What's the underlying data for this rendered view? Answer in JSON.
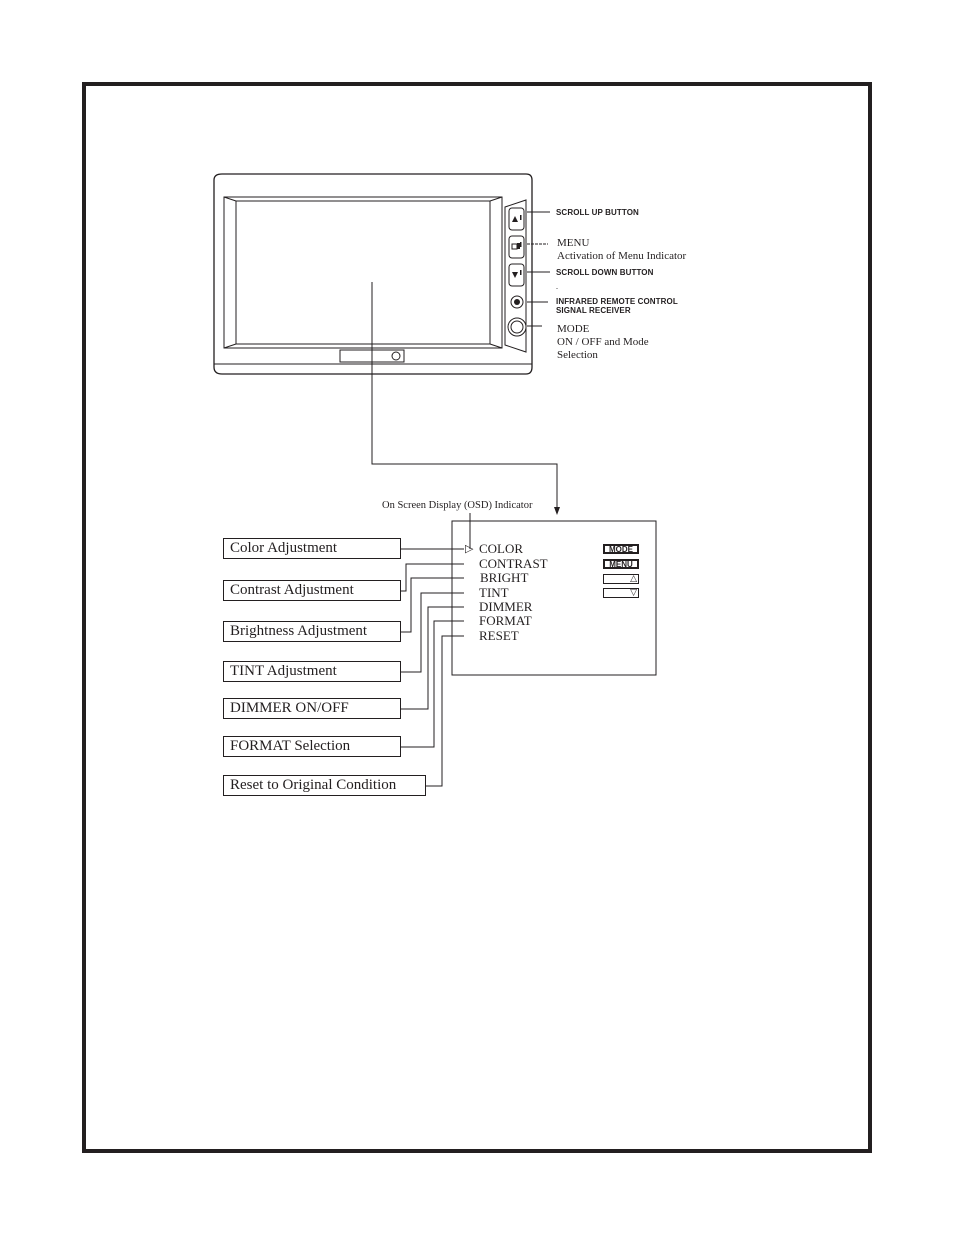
{
  "device": {
    "name": "monitor",
    "buttons": [
      {
        "id": "scroll-up",
        "icon": "triangle-up-icon",
        "glyph": "▲"
      },
      {
        "id": "menu",
        "icon": "menu-icon",
        "glyph": "◧"
      },
      {
        "id": "scroll-down",
        "icon": "triangle-down-icon",
        "glyph": "▼"
      },
      {
        "id": "ir-receiver",
        "icon": "ir-sensor-icon",
        "glyph": "●"
      },
      {
        "id": "mode",
        "icon": "circle-button-icon",
        "glyph": "○"
      }
    ]
  },
  "callouts": {
    "scroll_up": "SCROLL UP BUTTON",
    "menu_title": "MENU",
    "menu_desc": "Activation of Menu Indicator",
    "scroll_down": "SCROLL DOWN BUTTON",
    "ir_line1": "INFRARED REMOTE CONTROL",
    "ir_line2": "SIGNAL RECEIVER",
    "mode_title": "MODE",
    "mode_desc1": "ON / OFF and Mode",
    "mode_desc2": "Selection",
    "dot": "."
  },
  "osd": {
    "indicator_label": "On Screen Display (OSD) Indicator",
    "cursor_glyph": "▷",
    "items": [
      "COLOR",
      "CONTRAST",
      "BRIGHT",
      "TINT",
      "DIMMER",
      "FORMAT",
      "RESET"
    ],
    "keys": {
      "mode": "MODE",
      "menu": "MENU",
      "up_glyph": "△",
      "down_glyph": "▽"
    }
  },
  "functions": [
    "Color  Adjustment",
    "Contrast  Adjustment",
    "Brightness  Adjustment",
    "TINT  Adjustment",
    "DIMMER    ON/OFF",
    "FORMAT  Selection",
    "Reset  to  Original  Condition"
  ],
  "colors": {
    "ink": "#231f20",
    "paper": "#ffffff"
  }
}
